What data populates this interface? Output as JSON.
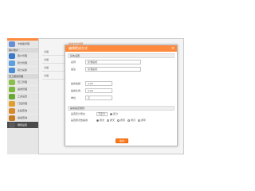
{
  "background": {
    "tab_label": "提成方式详细",
    "rows": [
      "分组",
      "分组",
      "分组",
      "分组"
    ]
  },
  "sidebar": {
    "items": [
      {
        "label": "卡模板管理",
        "icon": "card-icon",
        "color": "#6b8fd6"
      },
      {
        "group": "客户账户"
      },
      {
        "label": "客户管理",
        "icon": "user-icon",
        "color": "#3a78c8"
      },
      {
        "label": "积分管理",
        "icon": "coin-icon",
        "color": "#5aa0e0"
      },
      {
        "label": "积分兑换",
        "icon": "gift-icon",
        "color": "#4a8ed8"
      },
      {
        "group": "员工服务管理"
      },
      {
        "label": "员工管理",
        "icon": "staff-icon",
        "color": "#8ac04a"
      },
      {
        "label": "提成管理",
        "icon": "commission-icon",
        "color": "#7cb83a"
      },
      {
        "label": "工资设置",
        "icon": "wallet-icon",
        "color": "#6aa832"
      },
      {
        "label": "门店管理",
        "icon": "store-icon",
        "color": "#e0a030"
      },
      {
        "label": "业绩查询",
        "icon": "chart-icon",
        "color": "#d88a2a"
      },
      {
        "label": "提成查询",
        "icon": "search-icon",
        "color": "#c87a22"
      },
      {
        "label": "规则设置",
        "icon": "settings-icon",
        "color": "#5a5a5a",
        "active": true
      }
    ]
  },
  "dialog": {
    "title": "编辑提成方式",
    "close": "×",
    "section_basic": "基本设置",
    "fields": {
      "name_label": "名称",
      "name_value": "标准提成",
      "remark_label": "备注",
      "remark_value": "标准提成",
      "value1_label": "提成金额",
      "value1": "0.00",
      "value2_label": "提成比例",
      "value2": "0.00",
      "unit_label": "单位",
      "unit_value": "元"
    },
    "section_advanced": "提成指定规则",
    "radio1_label": "是否区分男女",
    "radio1_options": [
      "不区分",
      "区分"
    ],
    "radio2_label": "是否按次数提成",
    "radio2_options": [
      "按次",
      "按天",
      "按周",
      "按月",
      "按年"
    ],
    "submit": "提交"
  }
}
